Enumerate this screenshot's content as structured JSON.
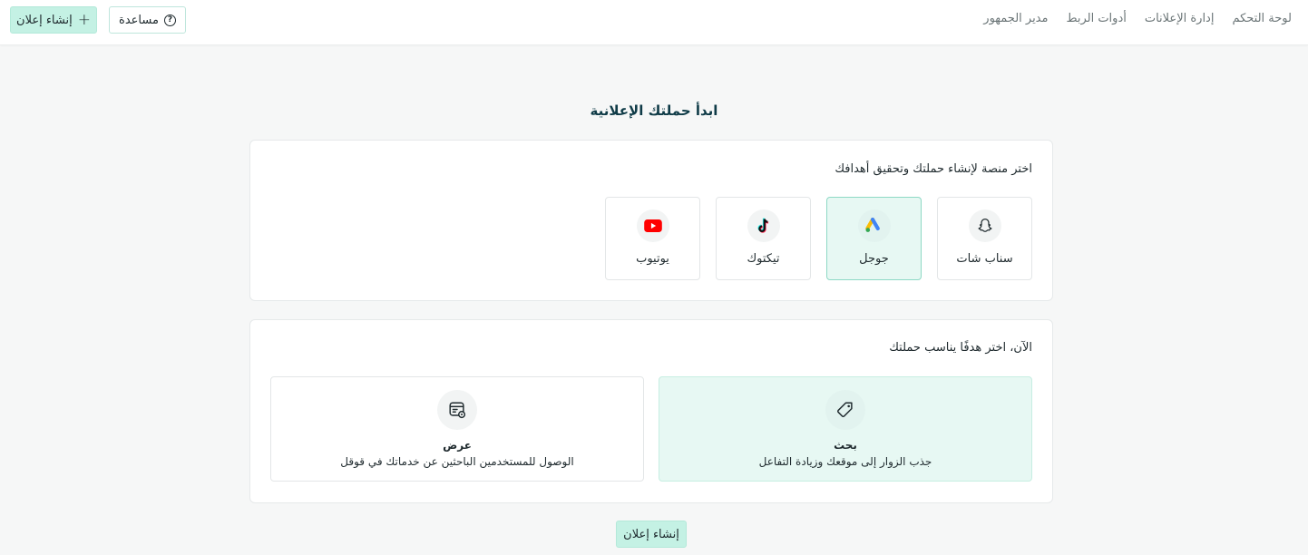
{
  "nav": {
    "items": [
      {
        "label": "لوحة التحكم"
      },
      {
        "label": "إدارة الإعلانات"
      },
      {
        "label": "أدوات الربط"
      },
      {
        "label": "مدير الجمهور"
      }
    ]
  },
  "header_actions": {
    "create_label": "إنشاء إعلان",
    "help_label": "مساعدة",
    "create_icon": "plus-icon",
    "help_icon": "question-circle-icon"
  },
  "page": {
    "title": "ابدأ حملتك الإعلانية"
  },
  "platform_section": {
    "heading": "اختر منصة لإنشاء حملتك وتحقيق أهدافك",
    "platforms": [
      {
        "label": "سناب شات",
        "icon": "snapchat-icon",
        "selected": false
      },
      {
        "label": "جوجل",
        "icon": "google-ads-icon",
        "selected": true
      },
      {
        "label": "تيكتوك",
        "icon": "tiktok-icon",
        "selected": false
      },
      {
        "label": "يوتيوب",
        "icon": "youtube-icon",
        "selected": false
      }
    ]
  },
  "goal_section": {
    "heading": "الآن، اختر هدفًا يناسب حملتك",
    "goals": [
      {
        "title": "بحث",
        "description": "جذب الزوار إلى موقعك وزيادة التفاعل",
        "icon": "tag-icon",
        "selected": true
      },
      {
        "title": "عرض",
        "description": "الوصول للمستخدمين الباحثين عن خدماتك في قوقل",
        "icon": "display-ad-icon",
        "selected": false
      }
    ]
  },
  "footer": {
    "create_label": "إنشاء إعلان"
  },
  "colors": {
    "accent": "#c4f1e4",
    "accent_border": "#8ed9c5",
    "selected_bg": "#e7f8f3",
    "title": "#0f3b47"
  }
}
